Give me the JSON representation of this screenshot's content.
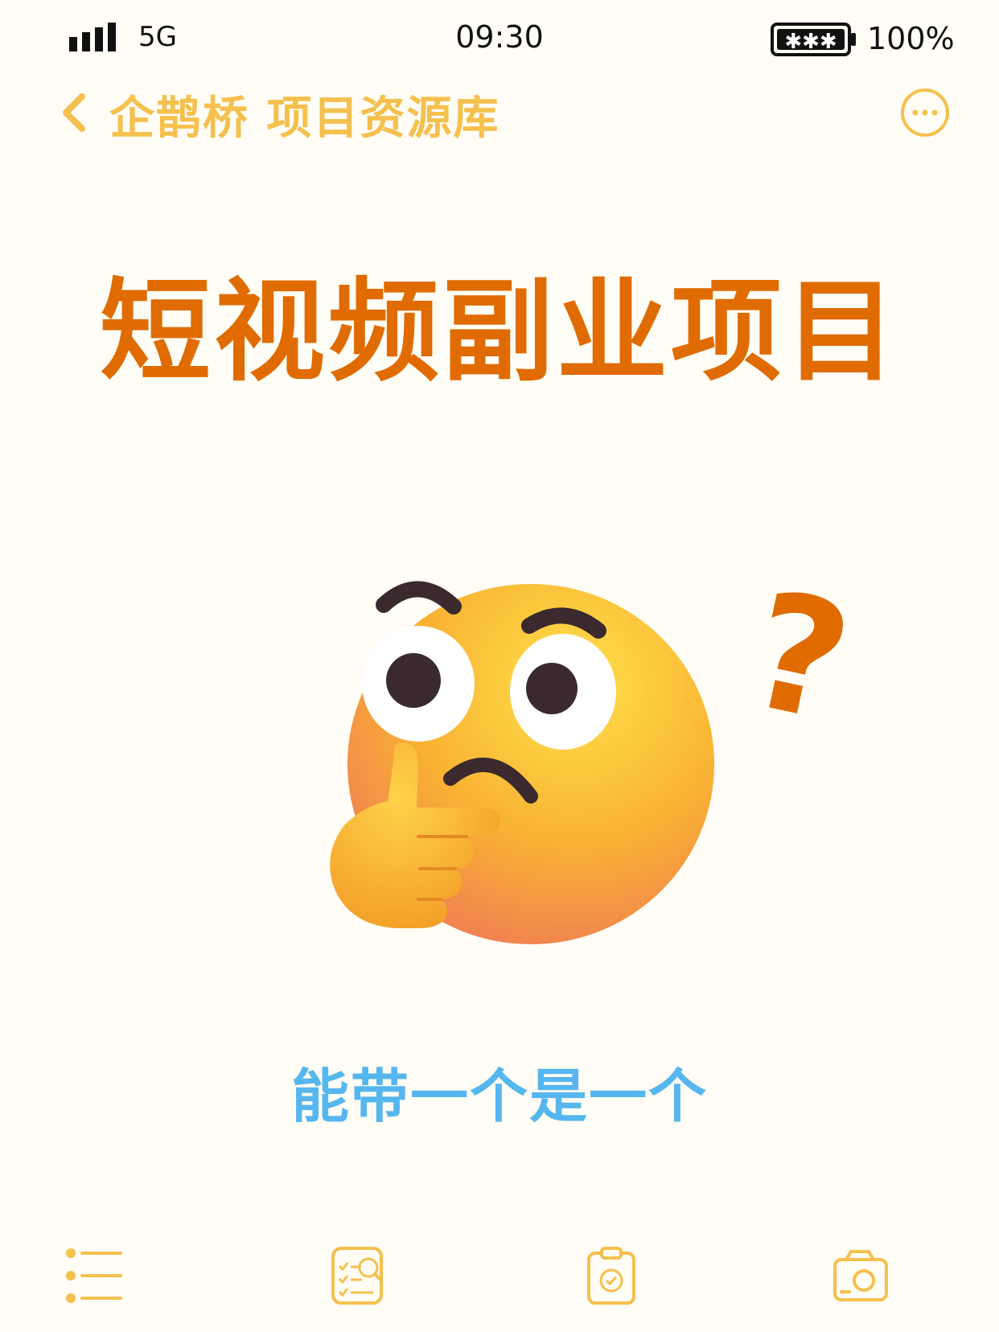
{
  "status_bar": {
    "network": "5G",
    "time": "09:30",
    "battery": "100%"
  },
  "nav": {
    "title": "企鹊桥 项目资源库",
    "back_icon": "chevron-left-icon",
    "more_icon": "more-horizontal-icon"
  },
  "content": {
    "headline": "短视频副业项目",
    "question_mark": "?",
    "subtitle": "能带一个是一个",
    "emoji": "thinking-face-icon"
  },
  "toolbar": {
    "items": [
      {
        "icon": "checklist-icon"
      },
      {
        "icon": "search-document-icon"
      },
      {
        "icon": "clipboard-check-icon"
      },
      {
        "icon": "camera-icon"
      }
    ]
  },
  "colors": {
    "accent": "#f5c04d",
    "headline": "#e06b00",
    "subtitle": "#56b6ef",
    "background": "#fffdf5"
  }
}
